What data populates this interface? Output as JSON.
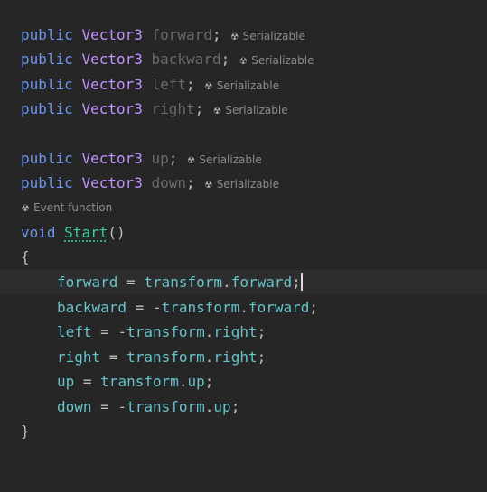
{
  "editor": {
    "fields": [
      {
        "modifier": "public",
        "type": "Vector3",
        "name": "forward",
        "hint": "Serializable"
      },
      {
        "modifier": "public",
        "type": "Vector3",
        "name": "backward",
        "hint": "Serializable"
      },
      {
        "modifier": "public",
        "type": "Vector3",
        "name": "left",
        "hint": "Serializable"
      },
      {
        "modifier": "public",
        "type": "Vector3",
        "name": "right",
        "hint": "Serializable"
      },
      {
        "modifier": "public",
        "type": "Vector3",
        "name": "up",
        "hint": "Serializable"
      },
      {
        "modifier": "public",
        "type": "Vector3",
        "name": "down",
        "hint": "Serializable"
      }
    ],
    "event_hint": "Event function",
    "method": {
      "return_type": "void",
      "name": "Start",
      "params": "()"
    },
    "open_brace": "{",
    "close_brace": "}",
    "body": [
      {
        "target": "forward",
        "op": " = ",
        "neg": "",
        "obj": "transform",
        "dot": ".",
        "prop": "forward",
        "end": ";"
      },
      {
        "target": "backward",
        "op": " = ",
        "neg": "-",
        "obj": "transform",
        "dot": ".",
        "prop": "forward",
        "end": ";"
      },
      {
        "target": "left",
        "op": " = ",
        "neg": "-",
        "obj": "transform",
        "dot": ".",
        "prop": "right",
        "end": ";"
      },
      {
        "target": "right",
        "op": " = ",
        "neg": "",
        "obj": "transform",
        "dot": ".",
        "prop": "right",
        "end": ";"
      },
      {
        "target": "up",
        "op": " = ",
        "neg": "",
        "obj": "transform",
        "dot": ".",
        "prop": "up",
        "end": ";"
      },
      {
        "target": "down",
        "op": " = ",
        "neg": "-",
        "obj": "transform",
        "dot": ".",
        "prop": "up",
        "end": ";"
      }
    ],
    "colors": {
      "background": "#262626",
      "current_line": "#2d2d2d",
      "keyword": "#6c95eb",
      "type": "#c191ff",
      "unused_field": "#6a6a6a",
      "member": "#66c3cc",
      "method": "#39cc9b",
      "hint": "#8c8c8c"
    },
    "icons": {
      "hint_icon": "unity-hint-icon"
    }
  }
}
